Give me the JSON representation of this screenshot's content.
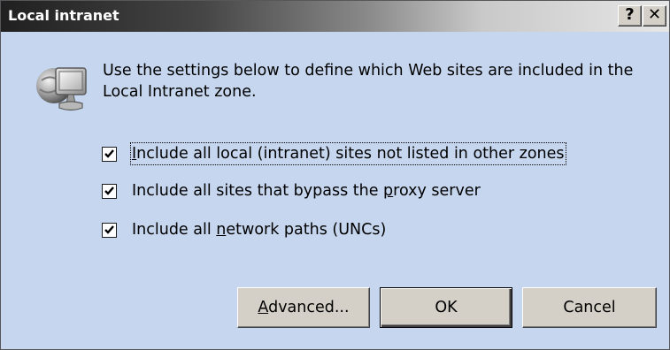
{
  "window": {
    "title": "Local intranet",
    "help_label": "?",
    "close_label": "✕"
  },
  "icon": "intranet-computer-globe-icon",
  "description": "Use the settings below to define which Web sites are included in the Local Intranet zone.",
  "options": [
    {
      "label_before": "",
      "mnemonic": "I",
      "label_after": "nclude all local (intranet) sites not listed in other zones",
      "checked": true,
      "focused": true
    },
    {
      "label_before": "Include all sites that bypass the ",
      "mnemonic": "p",
      "label_after": "roxy server",
      "checked": true,
      "focused": false
    },
    {
      "label_before": "Include all ",
      "mnemonic": "n",
      "label_after": "etwork paths (UNCs)",
      "checked": true,
      "focused": false
    }
  ],
  "buttons": {
    "advanced": {
      "mnemonic": "A",
      "rest": "dvanced..."
    },
    "ok": "OK",
    "cancel": "Cancel"
  },
  "colors": {
    "dialog_background": "#c5d6ee",
    "button_face": "#d4d0c8"
  }
}
